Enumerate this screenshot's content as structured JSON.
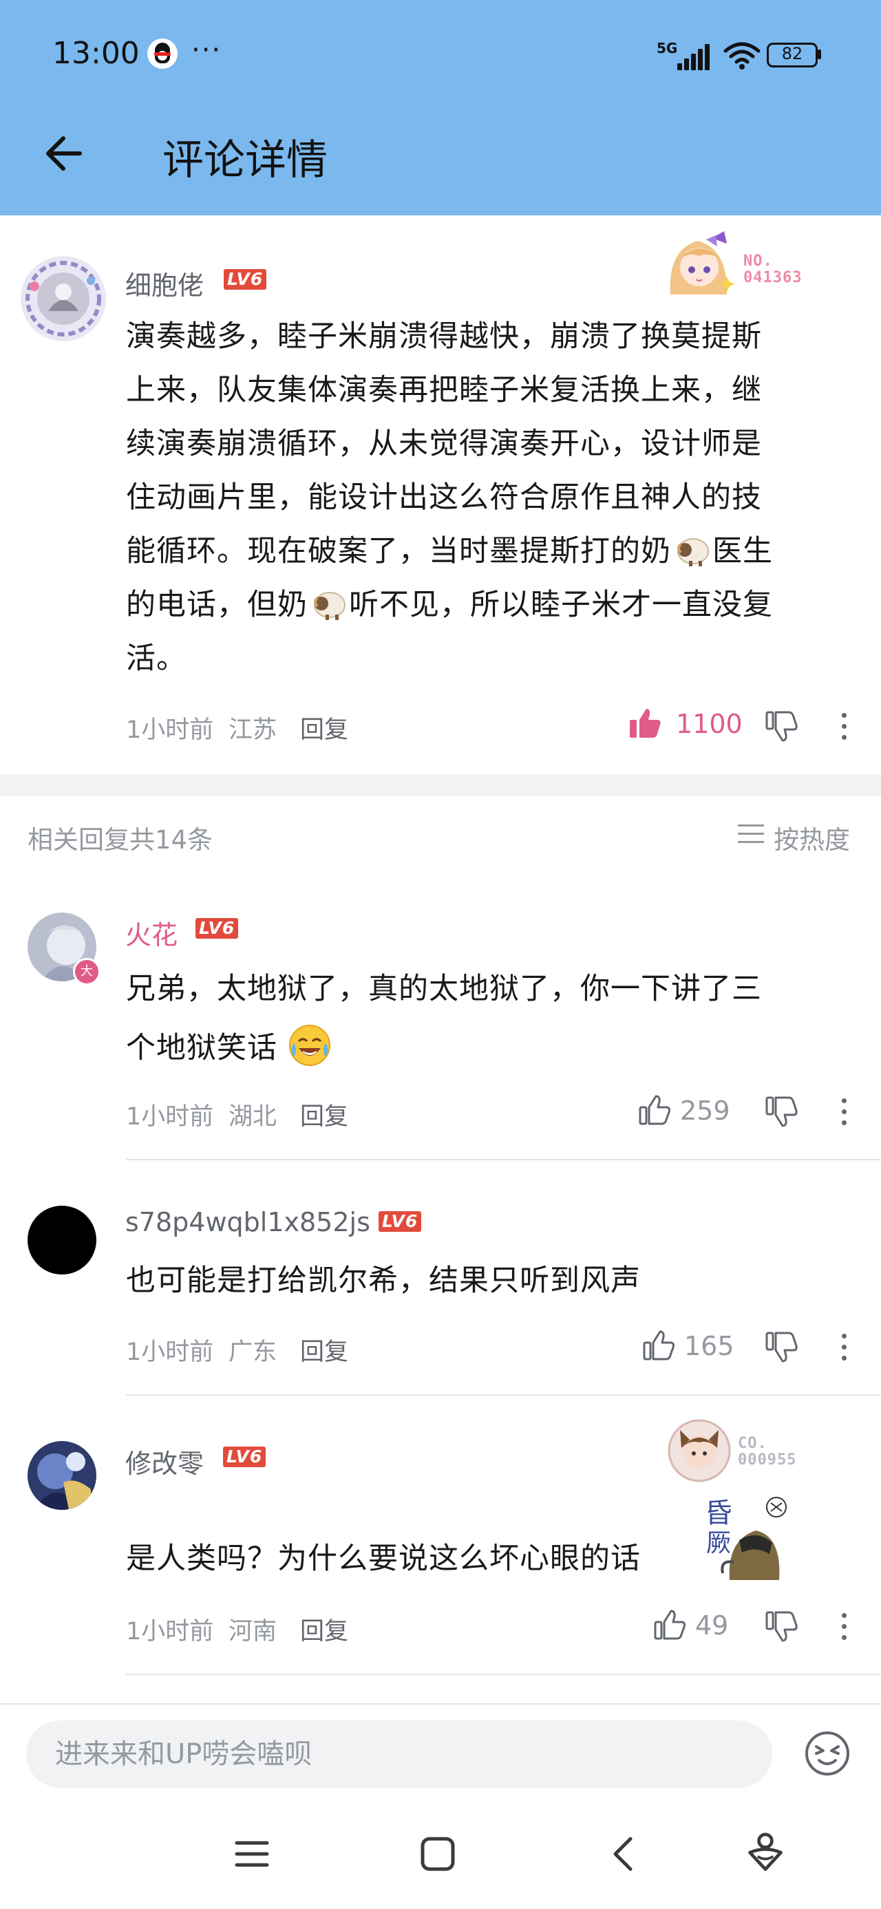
{
  "status_bar": {
    "time": "13:00",
    "dots": "···",
    "network": "5G",
    "battery": "82"
  },
  "header": {
    "title": "评论详情"
  },
  "main_comment": {
    "username": "细胞佬",
    "level": "LV6",
    "badge_no_label": "NO.",
    "badge_no": "041363",
    "lines": [
      "演奏越多，睦子米崩溃得越快，崩溃了换莫提斯",
      "上来，队友集体演奏再把睦子米复活换上来，继",
      "续演奏崩溃循环，从未觉得演奏开心，设计师是",
      "住动画片里，能设计出这么符合原作且神人的技",
      "能循环。现在破案了，当时墨提斯打的奶",
      "医生",
      "的电话，但奶",
      "听不见，所以睦子米才一直没复",
      "活。"
    ],
    "time": "1小时前",
    "location": "江苏",
    "reply_label": "回复",
    "likes": "1100"
  },
  "replies_header": {
    "count_label": "相关回复共14条",
    "sort_label": "按热度"
  },
  "replies": [
    {
      "username": "火花",
      "level": "LV6",
      "avatar_badge": "大",
      "lines": [
        "兄弟，太地狱了，真的太地狱了，你一下讲了三",
        "个地狱笑话"
      ],
      "time": "1小时前",
      "location": "湖北",
      "reply_label": "回复",
      "likes": "259"
    },
    {
      "username": "s78p4wqbl1x852js",
      "level": "LV6",
      "lines": [
        "也可能是打给凯尔希，结果只听到风声"
      ],
      "time": "1小时前",
      "location": "广东",
      "reply_label": "回复",
      "likes": "165"
    },
    {
      "username": "修改零",
      "level": "LV6",
      "badge_no_label": "CO.",
      "badge_no": "000955",
      "lines": [
        "是人类吗？为什么要说这么坏心眼的话"
      ],
      "time": "1小时前",
      "location": "河南",
      "reply_label": "回复",
      "likes": "49"
    }
  ],
  "input": {
    "placeholder": "进来来和UP唠会嗑呗"
  },
  "icons": {
    "back": "arrow-left-icon",
    "like": "thumbs-up-icon",
    "dislike": "thumbs-down-icon",
    "more": "more-vertical-icon",
    "sort": "sort-lines-icon",
    "emoji": "emoji-face-icon",
    "nav_menu": "menu-icon",
    "nav_home": "square-home-icon",
    "nav_back": "chevron-left-icon",
    "nav_assistant": "assistant-icon"
  },
  "colors": {
    "header_bg": "#7ab8ee",
    "accent_pink": "#e15b87",
    "level_badge": "#e24b3c",
    "text_gray": "#9499a0"
  }
}
